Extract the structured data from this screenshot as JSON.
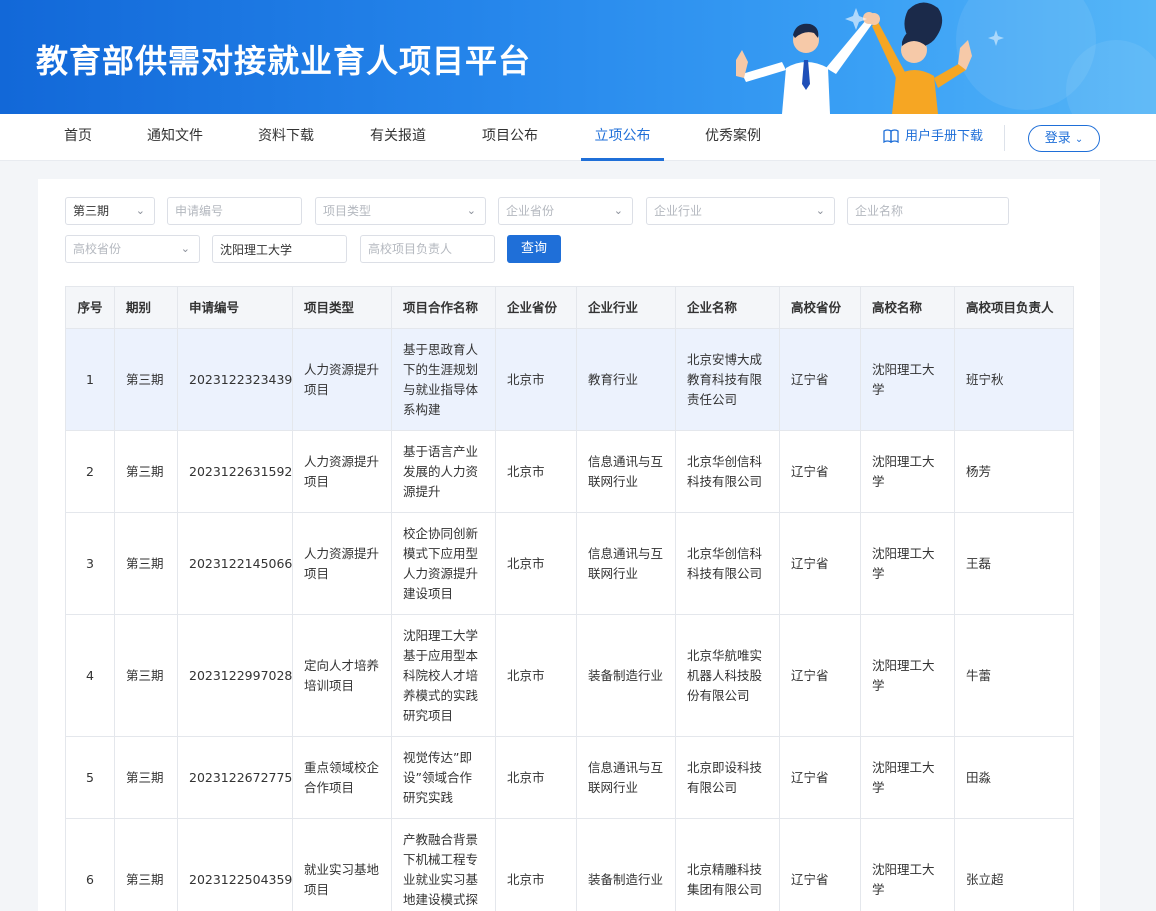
{
  "banner": {
    "title": "教育部供需对接就业育人项目平台"
  },
  "nav": {
    "items": [
      {
        "label": "首页"
      },
      {
        "label": "通知文件"
      },
      {
        "label": "资料下载"
      },
      {
        "label": "有关报道"
      },
      {
        "label": "项目公布"
      },
      {
        "label": "立项公布"
      },
      {
        "label": "优秀案例"
      }
    ],
    "active_index": 5,
    "manual_label": "用户手册下载",
    "login_label": "登录"
  },
  "filters": {
    "period": "第三期",
    "application_no_placeholder": "申请编号",
    "project_type_placeholder": "项目类型",
    "company_province_placeholder": "企业省份",
    "company_industry_placeholder": "企业行业",
    "company_name_placeholder": "企业名称",
    "school_province_placeholder": "高校省份",
    "school_name_value": "沈阳理工大学",
    "leader_placeholder": "高校项目负责人",
    "query_label": "查询"
  },
  "table": {
    "headers": [
      "序号",
      "期别",
      "申请编号",
      "项目类型",
      "项目合作名称",
      "企业省份",
      "企业行业",
      "企业名称",
      "高校省份",
      "高校名称",
      "高校项目负责人"
    ],
    "rows": [
      [
        "1",
        "第三期",
        "2023122323439",
        "人力资源提升项目",
        "基于思政育人下的生涯规划与就业指导体系构建",
        "北京市",
        "教育行业",
        "北京安博大成教育科技有限责任公司",
        "辽宁省",
        "沈阳理工大学",
        "班宁秋"
      ],
      [
        "2",
        "第三期",
        "2023122631592",
        "人力资源提升项目",
        "基于语言产业发展的人力资源提升",
        "北京市",
        "信息通讯与互联网行业",
        "北京华创信科科技有限公司",
        "辽宁省",
        "沈阳理工大学",
        "杨芳"
      ],
      [
        "3",
        "第三期",
        "2023122145066",
        "人力资源提升项目",
        "校企协同创新模式下应用型人力资源提升建设项目",
        "北京市",
        "信息通讯与互联网行业",
        "北京华创信科科技有限公司",
        "辽宁省",
        "沈阳理工大学",
        "王磊"
      ],
      [
        "4",
        "第三期",
        "2023122997028",
        "定向人才培养培训项目",
        "沈阳理工大学基于应用型本科院校人才培养模式的实践研究项目",
        "北京市",
        "装备制造行业",
        "北京华航唯实机器人科技股份有限公司",
        "辽宁省",
        "沈阳理工大学",
        "牛蕾"
      ],
      [
        "5",
        "第三期",
        "2023122672775",
        "重点领域校企合作项目",
        "视觉传达”即设”领域合作研究实践",
        "北京市",
        "信息通讯与互联网行业",
        "北京即设科技有限公司",
        "辽宁省",
        "沈阳理工大学",
        "田淼"
      ],
      [
        "6",
        "第三期",
        "2023122504359",
        "就业实习基地项目",
        "产教融合背景下机械工程专业就业实习基地建设模式探索与实践",
        "北京市",
        "装备制造行业",
        "北京精雕科技集团有限公司",
        "辽宁省",
        "沈阳理工大学",
        "张立超"
      ]
    ]
  },
  "colors": {
    "primary": "#1f6fd8",
    "header_bg": "#f4f6f9",
    "highlight_row": "#ecf2fd",
    "banner_start": "#1268d8",
    "banner_end": "#56b6f7"
  }
}
